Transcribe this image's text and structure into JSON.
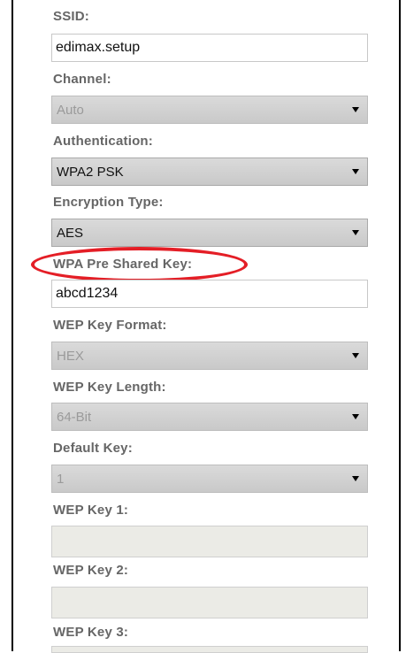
{
  "ssid": {
    "label": "SSID:",
    "value": "edimax.setup"
  },
  "channel": {
    "label": "Channel:",
    "value": "Auto"
  },
  "authentication": {
    "label": "Authentication:",
    "value": "WPA2 PSK"
  },
  "encryption": {
    "label": "Encryption Type:",
    "value": "AES"
  },
  "wpa_key": {
    "label": "WPA Pre Shared Key:",
    "value": "abcd1234"
  },
  "wep_format": {
    "label": "WEP Key Format:",
    "value": "HEX"
  },
  "wep_length": {
    "label": "WEP Key Length:",
    "value": "64-Bit"
  },
  "default_key": {
    "label": "Default Key:",
    "value": "1"
  },
  "wep_key1": {
    "label": "WEP Key 1:",
    "value": ""
  },
  "wep_key2": {
    "label": "WEP Key 2:",
    "value": ""
  },
  "wep_key3": {
    "label": "WEP Key 3:",
    "value": ""
  },
  "colors": {
    "highlight": "#e41e26",
    "label": "#666666",
    "select_bg": "#d0d0d0"
  }
}
